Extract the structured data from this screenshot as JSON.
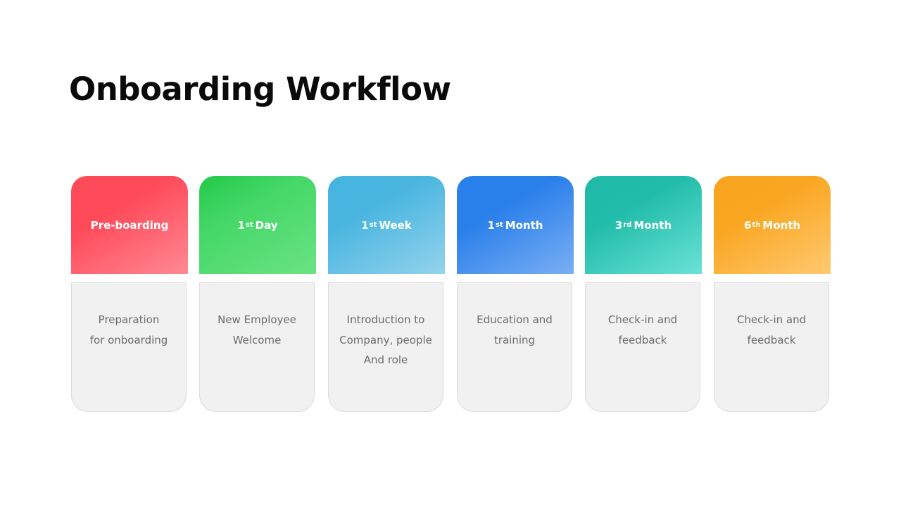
{
  "title": "Onboarding Workflow",
  "steps": [
    {
      "num": "",
      "sup": "",
      "label": "Pre-boarding",
      "color_start": "#ff4a5a",
      "color_mid": "#ff4a5a",
      "color_end": "#ff8a92",
      "lines": [
        "Preparation",
        "for onboarding"
      ]
    },
    {
      "num": "1",
      "sup": "st",
      "label": "Day",
      "color_start": "#22c948",
      "color_mid": "#44d767",
      "color_end": "#6be383",
      "lines": [
        "New Employee",
        "Welcome"
      ]
    },
    {
      "num": "1",
      "sup": "st",
      "label": "Week",
      "color_start": "#44b4e0",
      "color_mid": "#4ab6e0",
      "color_end": "#94d3ec",
      "lines": [
        "Introduction to",
        "Company, people",
        "And role"
      ]
    },
    {
      "num": "1",
      "sup": "st",
      "label": "Month",
      "color_start": "#2a80ea",
      "color_mid": "#2a80ea",
      "color_end": "#7aaff4",
      "lines": [
        "Education and",
        "training"
      ]
    },
    {
      "num": "3",
      "sup": "rd",
      "label": "Month",
      "color_start": "#1fbaa8",
      "color_mid": "#22bcaa",
      "color_end": "#6ae3d6",
      "lines": [
        "Check-in and",
        "feedback"
      ]
    },
    {
      "num": "6",
      "sup": "th",
      "label": "Month",
      "color_start": "#f9a41e",
      "color_mid": "#f9a620",
      "color_end": "#ffc970",
      "lines": [
        "Check-in and",
        "feedback"
      ]
    }
  ]
}
